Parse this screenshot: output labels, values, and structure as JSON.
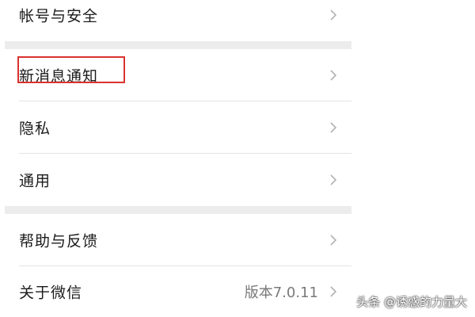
{
  "settings": {
    "account_security": "帐号与安全",
    "new_message_notify": "新消息通知",
    "privacy": "隐私",
    "general": "通用",
    "help_feedback": "帮助与反馈",
    "about_wechat": "关于微信",
    "version": "版本7.0.11"
  },
  "watermark": "头条 @诱惑的力量大",
  "colors": {
    "highlight_border": "#d9332f",
    "section_gap": "#ececec"
  }
}
